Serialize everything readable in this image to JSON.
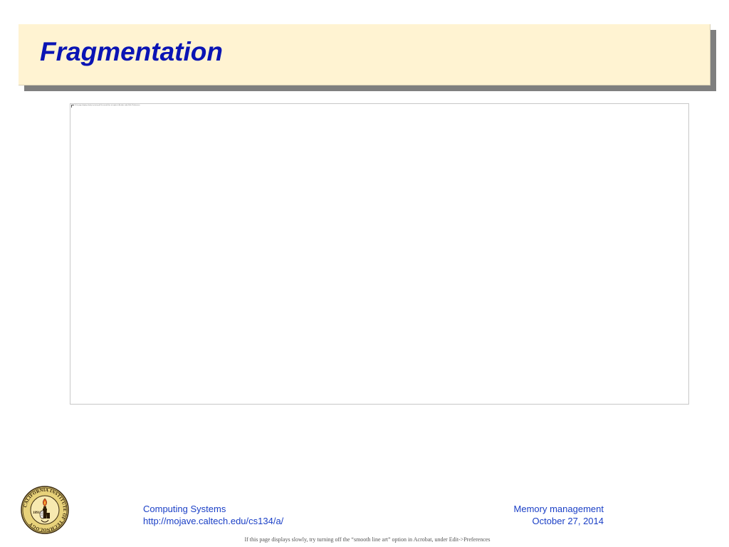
{
  "slide": {
    "title": "Fragmentation"
  },
  "figure": {
    "caption": "If this page displays slowly, try turning off the smooth line art option in Acrobat, under Edit->Preferences"
  },
  "logo": {
    "name": "caltech-seal-icon",
    "text": "CALIFORNIA INSTITUTE OF TECHNOLOGY",
    "year": "1891"
  },
  "footer": {
    "course": "Computing Systems",
    "url": "http://mojave.caltech.edu/cs134/a/",
    "topic": "Memory management",
    "date": "October 27, 2014",
    "note": "If this page displays slowly, try turning off the “smooth line art” option in Acrobat, under Edit->Preferences"
  },
  "colors": {
    "title_text": "#0a14b4",
    "title_background": "#fff3d2",
    "title_shadow": "#7f7f7f",
    "footer_text": "#1a3fc6"
  }
}
